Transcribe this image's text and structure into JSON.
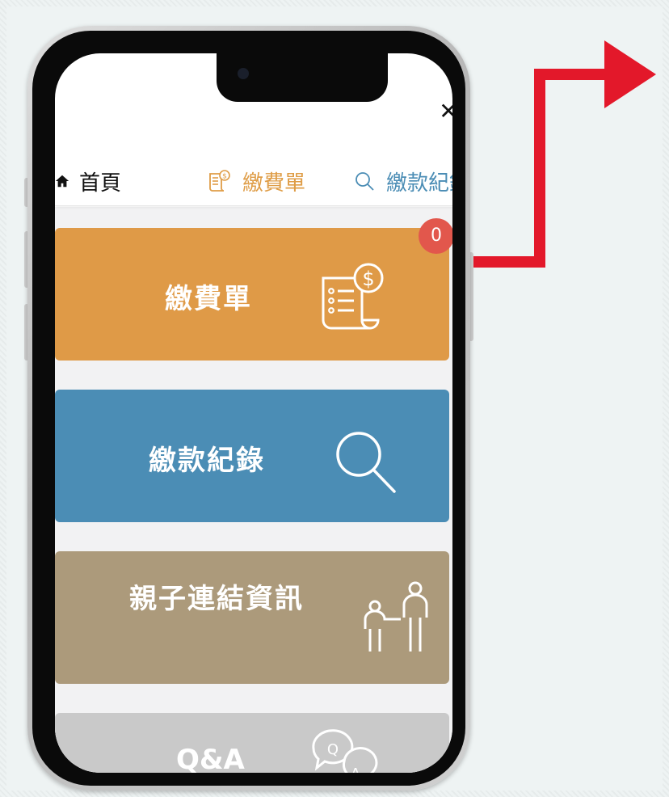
{
  "nav": {
    "home_label": "首頁",
    "bill_label": "繳費單",
    "records_label": "繳款紀錄"
  },
  "close_label": "✕",
  "cards": {
    "bill": {
      "label": "繳費單",
      "badge": "0"
    },
    "records": {
      "label": "繳款紀錄"
    },
    "parent_link": {
      "label": "親子連結資訊"
    },
    "qa": {
      "label": "Q&A"
    }
  },
  "icons": {
    "home": "home-icon",
    "bill": "bill-icon",
    "search": "search-icon",
    "family": "family-icon",
    "qa": "qa-bubbles-icon",
    "close": "close-icon"
  },
  "colors": {
    "bill": "#df9a47",
    "records": "#4b8db5",
    "parent_link": "#ac9a7b",
    "qa": "#c9c9c9",
    "badge": "#e2574c",
    "arrow": "#e3182a"
  }
}
